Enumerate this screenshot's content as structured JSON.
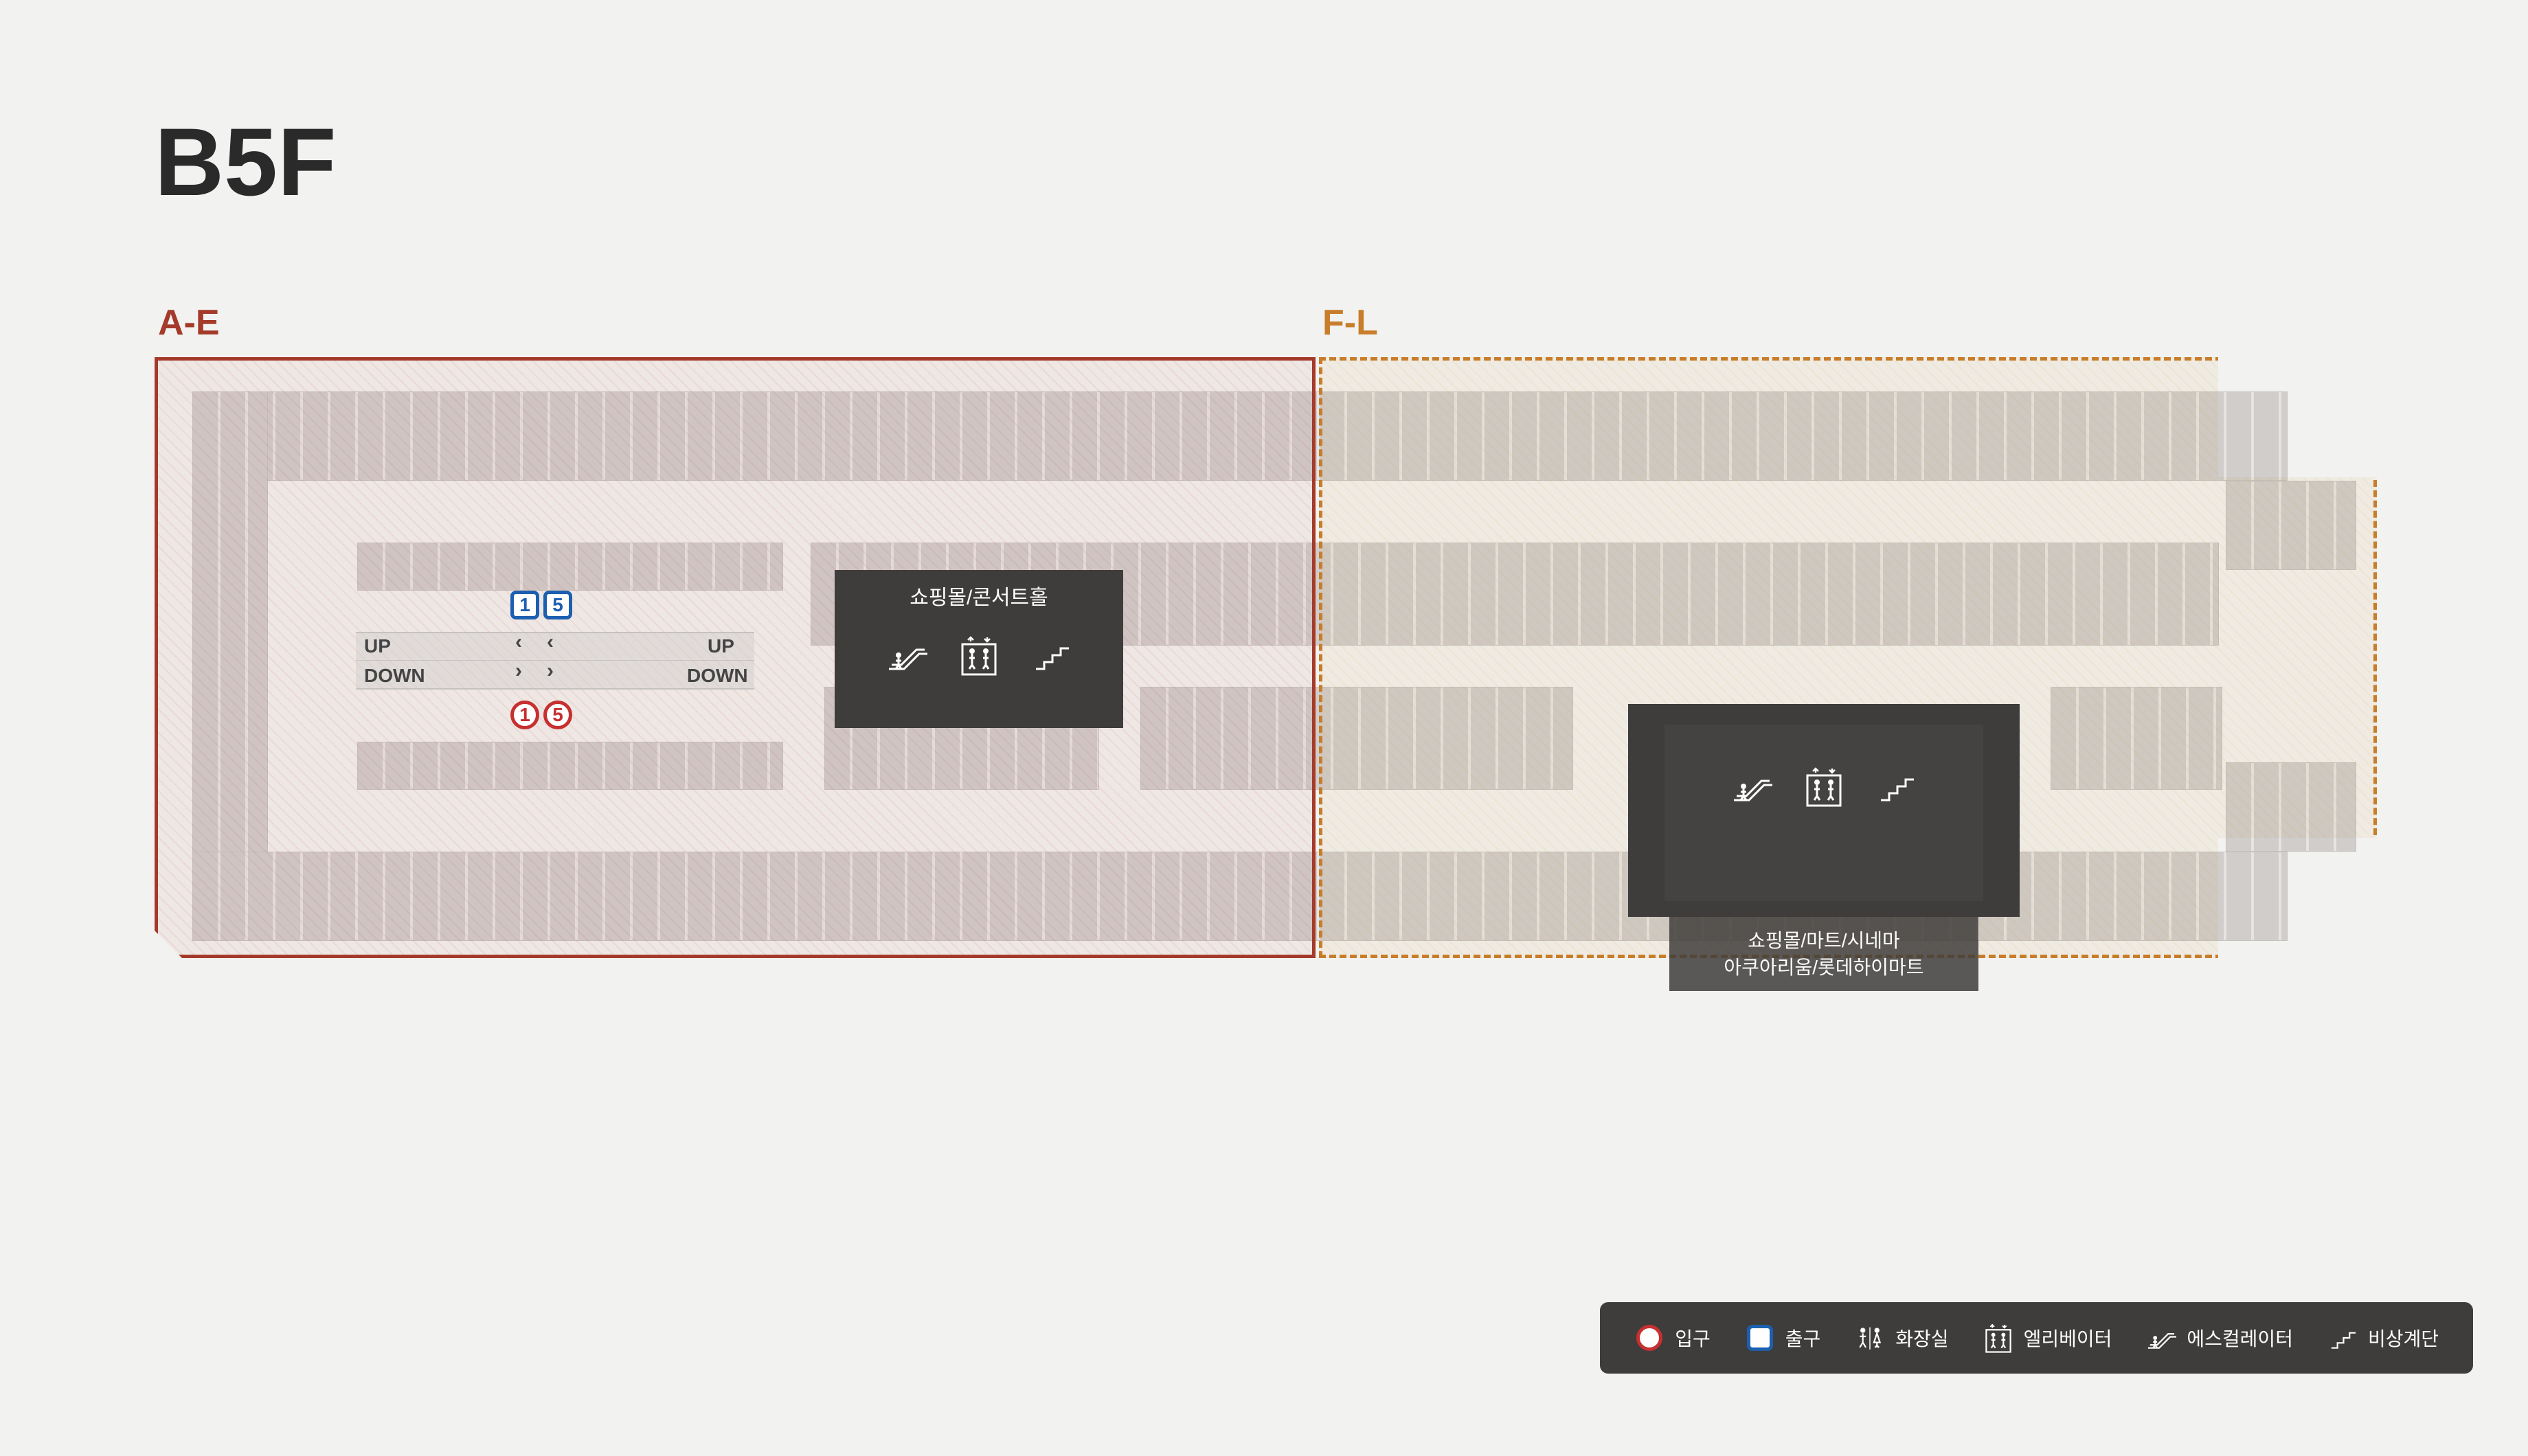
{
  "title": "B5F",
  "zones": {
    "ae": {
      "label": "A-E",
      "color": "#a43a2a"
    },
    "fl": {
      "label": "F-L",
      "color": "#c87d2a"
    }
  },
  "aisle": {
    "up": "UP",
    "down": "DOWN",
    "exit_badges": [
      "1",
      "5"
    ],
    "entry_badges": [
      "1",
      "5"
    ]
  },
  "amenity1": {
    "title": "쇼핑몰/콘서트홀",
    "icons": [
      "escalator",
      "elevator",
      "stairs"
    ]
  },
  "amenity2": {
    "title_line1": "쇼핑몰/마트/시네마",
    "title_line2": "아쿠아리움/롯데하이마트",
    "icons": [
      "escalator",
      "elevator",
      "stairs"
    ]
  },
  "legend": {
    "entry": "입구",
    "exit": "출구",
    "restroom": "화장실",
    "elevator": "엘리베이터",
    "escalator": "에스컬레이터",
    "stairs": "비상계단"
  }
}
